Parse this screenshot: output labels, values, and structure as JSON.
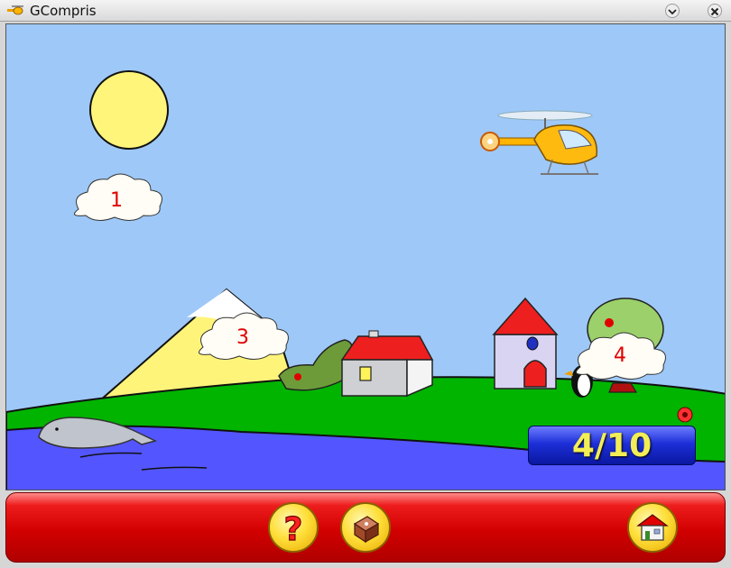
{
  "window": {
    "title": "GCompris"
  },
  "clouds": [
    {
      "number": "1"
    },
    {
      "number": "3"
    },
    {
      "number": "4"
    }
  ],
  "score": {
    "text": "4/10",
    "current": 4,
    "total": 10
  },
  "toolbar": {
    "help_symbol": "?",
    "buttons": [
      "help-button",
      "level-dice-button",
      "home-button"
    ]
  },
  "icons": [
    "helicopter-icon",
    "dropdown-chevron-icon",
    "close-icon",
    "question-mark-icon",
    "dice-icon",
    "house-icon"
  ],
  "colors": {
    "sky": "#9ec8f7",
    "grass": "#00b400",
    "water": "#5355ff",
    "bar": "#d20000",
    "score_text": "#f3ee55",
    "cloud_numbers": "#e00000"
  }
}
